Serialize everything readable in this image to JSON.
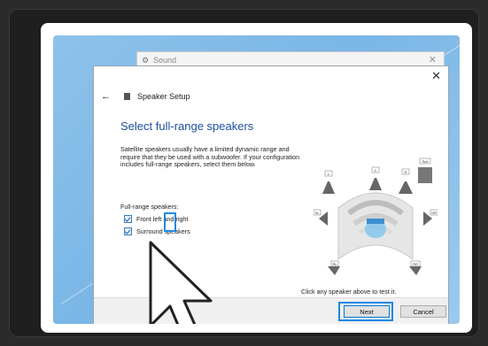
{
  "behind_window": {
    "title": "Sound",
    "gear_icon": "speaker-settings-icon",
    "close_icon": "close-icon"
  },
  "dialog": {
    "close_icon": "close-icon",
    "back_icon": "back-arrow-icon",
    "header_title": "Speaker Setup",
    "heading": "Select full-range speakers",
    "description": "Satellite speakers usually have a limited dynamic range and require that they be used with a subwoofer. If your configuration includes full-range speakers, select them below.",
    "full_range_label": "Full-range speakers:",
    "options": [
      {
        "label": "Front left and right",
        "checked": true
      },
      {
        "label": "Surround speakers",
        "checked": true
      }
    ],
    "test_hint": "Click any speaker above to test it.",
    "diagram_labels": [
      "L",
      "C",
      "R",
      "Sub",
      "SL",
      "SR",
      "RL",
      "RR"
    ]
  },
  "footer": {
    "next_label": "Next",
    "cancel_label": "Cancel"
  },
  "colors": {
    "accent": "#1e88e5",
    "heading": "#1d4fa0",
    "desktop_bg": "#8ec2ea"
  },
  "cursor_icon": "mouse-pointer-icon"
}
